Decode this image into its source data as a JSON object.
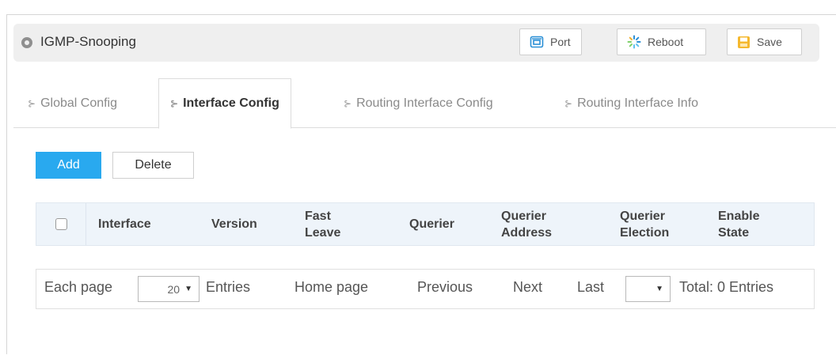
{
  "header": {
    "title": "IGMP-Snooping",
    "buttons": [
      {
        "label": "Port",
        "icon": "port-icon"
      },
      {
        "label": "Reboot",
        "icon": "reboot-icon"
      },
      {
        "label": "Save",
        "icon": "save-icon"
      }
    ]
  },
  "tabs": [
    {
      "label": "Global Config",
      "active": false
    },
    {
      "label": "Interface Config",
      "active": true
    },
    {
      "label": "Routing Interface Config",
      "active": false
    },
    {
      "label": "Routing Interface Info",
      "active": false
    }
  ],
  "actions": {
    "add_label": "Add",
    "delete_label": "Delete"
  },
  "table": {
    "columns": [
      {
        "line1": "Interface",
        "line2": ""
      },
      {
        "line1": "Version",
        "line2": ""
      },
      {
        "line1": "Fast",
        "line2": "Leave"
      },
      {
        "line1": "Querier",
        "line2": ""
      },
      {
        "line1": "Querier",
        "line2": "Address"
      },
      {
        "line1": "Querier",
        "line2": "Election"
      },
      {
        "line1": "Enable",
        "line2": "State"
      }
    ]
  },
  "pager": {
    "each_page": "Each page",
    "page_size": "20",
    "entries": "Entries",
    "home": "Home page",
    "previous": "Previous",
    "next": "Next",
    "last": "Last",
    "page_select": "",
    "total": "Total: 0 Entries"
  },
  "colors": {
    "accent": "#29a9ef",
    "header_bg": "#efefef",
    "table_header_bg": "#eef4fa"
  }
}
